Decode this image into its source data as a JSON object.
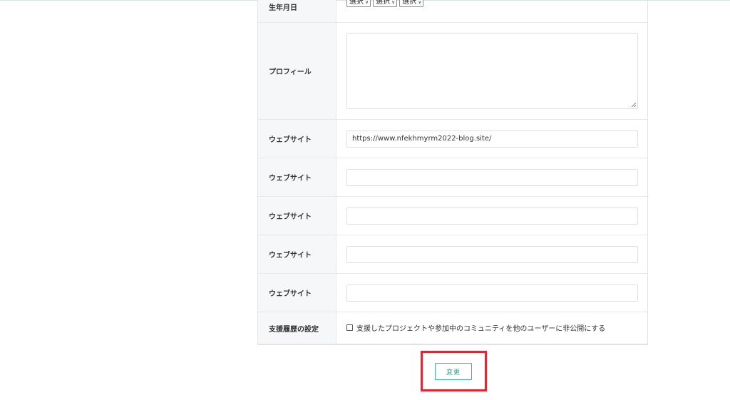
{
  "form": {
    "birthdate": {
      "label": "生年月日",
      "year_select": "選択",
      "month_select": "選択",
      "day_select": "選択"
    },
    "profile": {
      "label": "プロフィール",
      "value": ""
    },
    "websites": [
      {
        "label": "ウェブサイト",
        "value": "https://www.nfekhmyrm2022-blog.site/"
      },
      {
        "label": "ウェブサイト",
        "value": ""
      },
      {
        "label": "ウェブサイト",
        "value": ""
      },
      {
        "label": "ウェブサイト",
        "value": ""
      },
      {
        "label": "ウェブサイト",
        "value": ""
      }
    ],
    "support_history": {
      "label": "支援履歴の設定",
      "checkbox_label": "支援したプロジェクトや参加中のコミュニティを他のユーザーに非公開にする",
      "checked": false
    }
  },
  "submit": {
    "label": "変更"
  },
  "colors": {
    "accent": "#2fa89a",
    "highlight": "#e5252f",
    "label_bg": "#f6f7f8"
  }
}
